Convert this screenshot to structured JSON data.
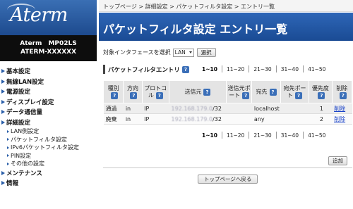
{
  "sidebar": {
    "logo": "Aterm",
    "model_line1": "Aterm　MP02LS",
    "model_line2": "ATERM-XXXXXX",
    "items": [
      {
        "label": "基本設定"
      },
      {
        "label": "無線LAN設定"
      },
      {
        "label": "電源設定"
      },
      {
        "label": "ディスプレイ設定"
      },
      {
        "label": "データ通信量"
      },
      {
        "label": "詳細設定"
      }
    ],
    "sub_items": [
      {
        "label": "LAN側設定"
      },
      {
        "label": "パケットフィルタ設定"
      },
      {
        "label": "IPv6パケットフィルタ設定"
      },
      {
        "label": "PIN設定"
      },
      {
        "label": "その他の設定"
      }
    ],
    "bottom_items": [
      {
        "label": "メンテナンス"
      },
      {
        "label": "情報"
      }
    ]
  },
  "breadcrumb": "トップページ > 詳細設定 > パケットフィルタ設定 > エントリ一覧",
  "page_title": "パケットフィルタ設定 エントリ一覧",
  "interface": {
    "label": "対象インタフェースを選択",
    "selected": "LAN",
    "button": "選択"
  },
  "section_title": "パケットフィルタエントリ",
  "help_glyph": "?",
  "pager": [
    "1~10",
    "11~20",
    "21~30",
    "31~40",
    "41~50"
  ],
  "table": {
    "headers": [
      "種別",
      "方向",
      "プロトコル",
      "送信元",
      "送信元ポート",
      "宛先",
      "宛先ポート",
      "優先度",
      "削除"
    ],
    "rows": [
      {
        "type": "通過",
        "dir": "in",
        "proto": "IP",
        "src": "192.168.179.0",
        "src_mask": "/32",
        "src_port": "",
        "dst": "localhost",
        "dst_port": "",
        "priority": "1",
        "delete": "削除"
      },
      {
        "type": "廃棄",
        "dir": "in",
        "proto": "IP",
        "src": "192.168.179.0",
        "src_mask": "/32",
        "src_port": "",
        "dst": "any",
        "dst_port": "",
        "priority": "2",
        "delete": "削除"
      }
    ]
  },
  "add_button": "追加",
  "top_button": "トップページへ戻る",
  "colors": {
    "accent": "#1f53a0",
    "link": "#1a43c8",
    "header_bg": "#e4e4e4"
  }
}
